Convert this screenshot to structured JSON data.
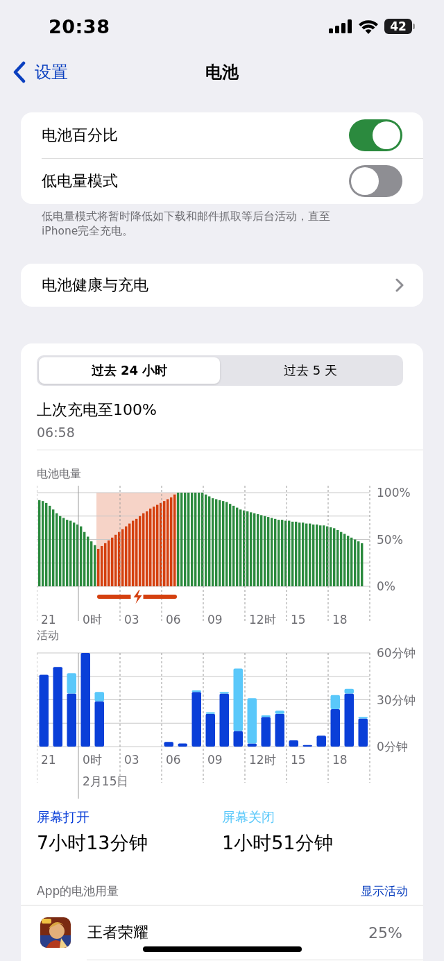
{
  "status_bar": {
    "time": "20:38",
    "battery": "42"
  },
  "nav": {
    "back": "设置",
    "title": "电池"
  },
  "toggles": [
    {
      "label": "电池百分比",
      "on": true
    },
    {
      "label": "低电量模式",
      "on": false
    }
  ],
  "toggles_footer": "低电量模式将暂时降低如下载和邮件抓取等后台活动，直至iPhone完全充电。",
  "health_row": {
    "label": "电池健康与充电"
  },
  "tabs": [
    {
      "label": "过去 24 小时",
      "selected": true
    },
    {
      "label": "过去 5 天",
      "selected": false
    }
  ],
  "last_charge": {
    "title": "上次充电至100%",
    "time": "06:58"
  },
  "battery_chart": {
    "x_labels": [
      "21",
      "0时",
      "03",
      "06",
      "09",
      "12时",
      "15",
      "18"
    ],
    "chart_data": {
      "type": "bar",
      "title": "电池电量",
      "stacked": true,
      "ylim": [
        0,
        100
      ],
      "yticks": [
        {
          "value": 0,
          "label": "0%"
        },
        {
          "value": 50,
          "label": "50%"
        },
        {
          "value": 100,
          "label": "100%"
        }
      ],
      "series": [
        {
          "color": "#2b8a3e",
          "values": [
            92,
            91,
            89,
            86,
            82,
            78,
            75,
            73,
            71,
            70,
            68,
            66,
            64,
            58,
            53,
            48,
            44,
            null,
            null,
            null,
            null,
            null,
            null,
            null,
            null,
            null,
            null,
            null,
            null,
            null,
            null,
            null,
            null,
            null,
            null,
            null,
            null,
            null,
            null,
            null,
            100,
            100,
            100,
            100,
            100,
            100,
            100,
            100,
            98,
            96,
            94,
            93,
            92,
            91,
            90,
            88,
            86,
            84,
            82,
            81,
            80,
            79,
            78,
            77,
            76,
            75,
            74,
            73,
            72,
            71,
            71,
            70,
            70,
            69,
            69,
            68,
            68,
            67,
            67,
            66,
            66,
            65,
            65,
            64,
            63,
            62,
            60,
            58,
            56,
            54,
            52,
            50,
            48,
            46
          ]
        },
        {
          "color": "#d4400f",
          "values": [
            null,
            null,
            null,
            null,
            null,
            null,
            null,
            null,
            null,
            null,
            null,
            null,
            null,
            null,
            null,
            null,
            null,
            40,
            43,
            46,
            49,
            52,
            55,
            58,
            61,
            64,
            67,
            70,
            72,
            75,
            78,
            80,
            83,
            85,
            87,
            89,
            91,
            93,
            95,
            98,
            null,
            null,
            null,
            null,
            null,
            null,
            null,
            null,
            null,
            null,
            null,
            null,
            null,
            null,
            null,
            null,
            null,
            null,
            null,
            null,
            null,
            null,
            null,
            null,
            null,
            null,
            null,
            null,
            null,
            null,
            null,
            null,
            null,
            null,
            null,
            null,
            null,
            null,
            null,
            null,
            null,
            null,
            null,
            null,
            null,
            null,
            null,
            null,
            null,
            null,
            null,
            null,
            null,
            null
          ]
        }
      ]
    }
  },
  "activity_chart": {
    "x_labels": [
      "21",
      "0时",
      "03",
      "06",
      "09",
      "12时",
      "15",
      "18"
    ],
    "date_label": "2月15日",
    "chart_data": {
      "type": "bar",
      "title": "活动",
      "stacked": true,
      "ylim": [
        0,
        60
      ],
      "yticks": [
        {
          "value": 0,
          "label": "0分钟"
        },
        {
          "value": 30,
          "label": "30分钟"
        },
        {
          "value": 60,
          "label": "60分钟"
        }
      ],
      "series": [
        {
          "name": "屏幕打开",
          "color": "#0a3fd8",
          "values": [
            46,
            51,
            34,
            60,
            29,
            0,
            0,
            0,
            0,
            3,
            2,
            35,
            21,
            34,
            10,
            2,
            19,
            21,
            4,
            1,
            7,
            24,
            34,
            18
          ]
        },
        {
          "name": "屏幕关闭",
          "color": "#5ac8fa",
          "values": [
            0,
            0,
            13,
            0,
            6,
            0,
            0,
            0,
            0,
            0,
            0,
            1,
            1,
            1,
            40,
            29,
            1,
            2,
            0,
            0,
            0,
            9,
            3,
            1
          ]
        }
      ]
    },
    "screen_summary": [
      "7小时13分钟",
      "1小时51分钟"
    ]
  },
  "usage": {
    "title": "App的电池用量",
    "action": "显示活动",
    "apps": [
      {
        "name": "王者荣耀",
        "percent": "25%"
      }
    ]
  }
}
